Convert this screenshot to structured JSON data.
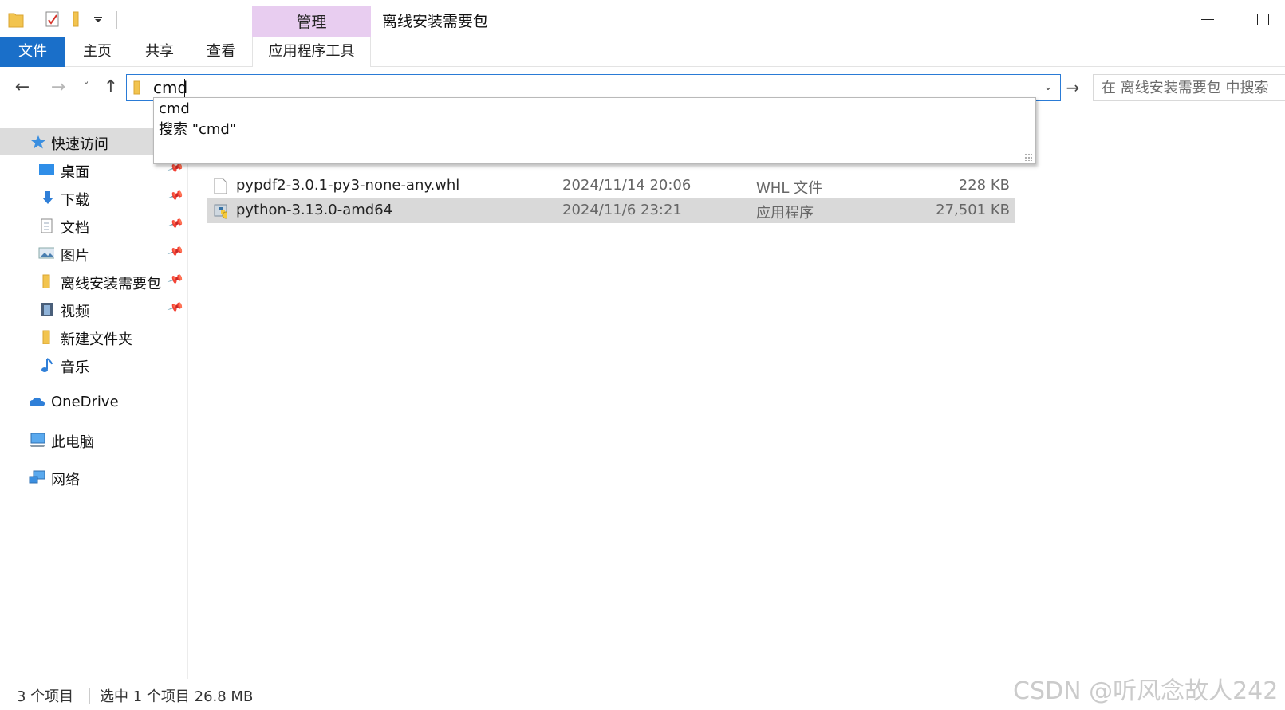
{
  "window": {
    "title": "离线安装需要包",
    "context_tab_group": "管理"
  },
  "ribbon": {
    "tabs": [
      "文件",
      "主页",
      "共享",
      "查看",
      "应用程序工具"
    ]
  },
  "address": {
    "value": "cmd",
    "search_placeholder": "在 离线安装需要包 中搜索"
  },
  "autocomplete": {
    "items": [
      "cmd",
      "搜索 \"cmd\""
    ]
  },
  "sidebar": {
    "items": [
      {
        "label": "快速访问",
        "icon": "star-icon"
      },
      {
        "label": "桌面",
        "icon": "desktop-icon",
        "pinned": true
      },
      {
        "label": "下载",
        "icon": "download-icon",
        "pinned": true
      },
      {
        "label": "文档",
        "icon": "document-icon",
        "pinned": true
      },
      {
        "label": "图片",
        "icon": "pictures-icon",
        "pinned": true
      },
      {
        "label": "离线安装需要包",
        "icon": "folder-icon",
        "pinned": true
      },
      {
        "label": "视频",
        "icon": "video-icon",
        "pinned": true
      },
      {
        "label": "新建文件夹",
        "icon": "folder-icon"
      },
      {
        "label": "音乐",
        "icon": "music-icon"
      },
      {
        "label": "OneDrive",
        "icon": "cloud-icon"
      },
      {
        "label": "此电脑",
        "icon": "computer-icon"
      },
      {
        "label": "网络",
        "icon": "network-icon"
      }
    ]
  },
  "files": [
    {
      "name": "pypdf2-3.0.1-py3-none-any.whl",
      "date": "2024/11/14 20:06",
      "type": "WHL 文件",
      "size": "228 KB"
    },
    {
      "name": "python-3.13.0-amd64",
      "date": "2024/11/6 23:21",
      "type": "应用程序",
      "size": "27,501 KB",
      "selected": true
    }
  ],
  "status": {
    "item_count": "3 个项目",
    "selection": "选中 1 个项目  26.8 MB"
  },
  "watermark": "CSDN @听风念故人242",
  "colors": {
    "accent": "#1a6fc9",
    "context_tab": "#e8cdf0",
    "address_border": "#2a7bd6",
    "selection": "#d9d9d9"
  }
}
